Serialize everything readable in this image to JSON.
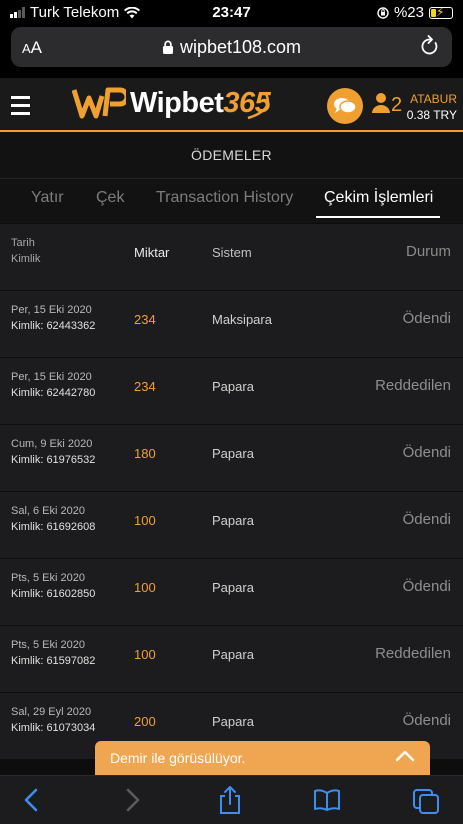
{
  "status": {
    "carrier": "Turk Telekom",
    "time": "23:47",
    "battery": "%23"
  },
  "browser": {
    "text_size": "AA",
    "url": "wipbet108.com"
  },
  "header": {
    "brand_main": "Wipbet",
    "brand_num": "365",
    "user_count": "2",
    "username": "ATABUR",
    "balance": "0.38 TRY"
  },
  "page_title": "ÖDEMELER",
  "tabs": [
    "Yatır",
    "Çek",
    "Transaction History",
    "Çekim İşlemleri"
  ],
  "table": {
    "headers": {
      "date": "Tarih",
      "id": "Kimlik",
      "amount": "Miktar",
      "system": "Sistem",
      "status": "Durum"
    },
    "rows": [
      {
        "date": "Per, 15 Eki 2020",
        "id": "Kimlik: 62443362",
        "amount": "234",
        "system": "Maksipara",
        "status": "Ödendi"
      },
      {
        "date": "Per, 15 Eki 2020",
        "id": "Kimlik: 62442780",
        "amount": "234",
        "system": "Papara",
        "status": "Reddedilen"
      },
      {
        "date": "Cum, 9 Eki 2020",
        "id": "Kimlik: 61976532",
        "amount": "180",
        "system": "Papara",
        "status": "Ödendi"
      },
      {
        "date": "Sal, 6 Eki 2020",
        "id": "Kimlik: 61692608",
        "amount": "100",
        "system": "Papara",
        "status": "Ödendi"
      },
      {
        "date": "Pts, 5 Eki 2020",
        "id": "Kimlik: 61602850",
        "amount": "100",
        "system": "Papara",
        "status": "Ödendi"
      },
      {
        "date": "Pts, 5 Eki 2020",
        "id": "Kimlik: 61597082",
        "amount": "100",
        "system": "Papara",
        "status": "Reddedilen"
      },
      {
        "date": "Sal, 29 Eyl 2020",
        "id": "Kimlik: 61073034",
        "amount": "200",
        "system": "Papara",
        "status": "Ödendi"
      }
    ]
  },
  "chat": {
    "label": "Demir ile görüsülüyor."
  },
  "colors": {
    "accent": "#f0a030",
    "row_bg": "#1c1c1e",
    "page_bg": "#0d0d0d"
  }
}
